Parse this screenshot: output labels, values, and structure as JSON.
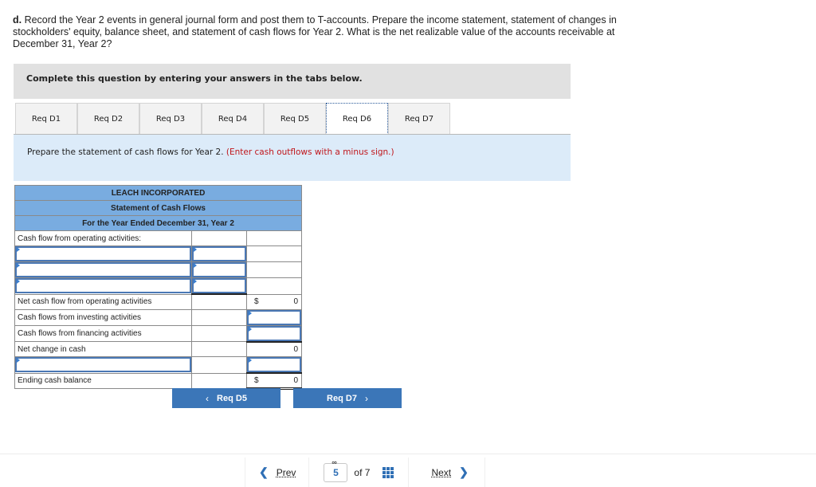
{
  "question": {
    "part_label": "d.",
    "text": " Record the Year 2 events in general journal form and post them to T-accounts. Prepare the income statement, statement of changes in stockholders' equity, balance sheet, and statement of cash flows for Year 2. What is the net realizable value of the accounts receivable at December 31, Year 2?"
  },
  "instructions": "Complete this question by entering your answers in the tabs below.",
  "tabs": [
    {
      "label": "Req D1",
      "active": false
    },
    {
      "label": "Req D2",
      "active": false
    },
    {
      "label": "Req D3",
      "active": false
    },
    {
      "label": "Req D4",
      "active": false
    },
    {
      "label": "Req D5",
      "active": false
    },
    {
      "label": "Req D6",
      "active": true
    },
    {
      "label": "Req D7",
      "active": false
    }
  ],
  "prompt": {
    "text": "Prepare the statement of cash flows for Year 2. ",
    "hint": "(Enter cash outflows with a minus sign.)"
  },
  "statement": {
    "company": "LEACH INCORPORATED",
    "title": "Statement of Cash Flows",
    "period": "For the Year Ended December 31, Year 2",
    "rows": {
      "operating_header": "Cash flow from operating activities:",
      "net_operating": {
        "label": "Net cash flow from operating activities",
        "currency": "$",
        "value": "0"
      },
      "investing": {
        "label": "Cash flows from investing activities",
        "value": ""
      },
      "financing": {
        "label": "Cash flows from financing activities",
        "value": ""
      },
      "net_change": {
        "label": "Net change in cash",
        "value": "0"
      },
      "ending": {
        "label": "Ending cash balance",
        "currency": "$",
        "value": "0"
      }
    },
    "inputs": {
      "op1_label": "",
      "op1_amount": "",
      "op2_label": "",
      "op2_amount": "",
      "op3_label": "",
      "op3_amount": "",
      "beginning_label": "",
      "beginning_amount": ""
    }
  },
  "nav": {
    "prev_button": "Req D5",
    "next_button": "Req D7"
  },
  "pager": {
    "prev": "Prev",
    "current_page": "5",
    "of_text": "of 7",
    "next": "Next"
  }
}
